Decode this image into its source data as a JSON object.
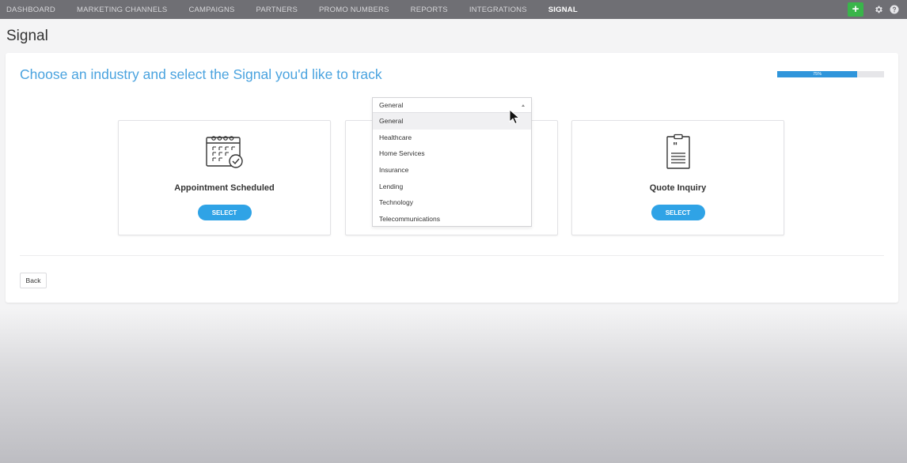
{
  "nav": {
    "items": [
      {
        "label": "DASHBOARD",
        "active": false
      },
      {
        "label": "MARKETING CHANNELS",
        "active": false
      },
      {
        "label": "CAMPAIGNS",
        "active": false
      },
      {
        "label": "PARTNERS",
        "active": false
      },
      {
        "label": "PROMO NUMBERS",
        "active": false
      },
      {
        "label": "REPORTS",
        "active": false
      },
      {
        "label": "INTEGRATIONS",
        "active": false
      },
      {
        "label": "SIGNAL",
        "active": true
      }
    ],
    "add_label": "+",
    "icons": [
      "plus-icon",
      "gear-icon",
      "help-icon"
    ]
  },
  "page": {
    "title": "Signal"
  },
  "panel": {
    "heading": "Choose an industry and select the Signal you'd like to track",
    "progress_label": "75%",
    "progress_value": 0.75,
    "cards": [
      {
        "title": "Appointment Scheduled",
        "button": "SELECT",
        "icon": "calendar-check-icon"
      },
      {
        "title": "",
        "button": "",
        "icon": ""
      },
      {
        "title": "Quote Inquiry",
        "button": "SELECT",
        "icon": "clipboard-quote-icon"
      }
    ],
    "back_label": "Back"
  },
  "industry_dropdown": {
    "selected": "General",
    "options": [
      "General",
      "Healthcare",
      "Home Services",
      "Insurance",
      "Lending",
      "Technology",
      "Telecommunications"
    ],
    "hovered": "General"
  },
  "colors": {
    "nav_bg": "#6f6f74",
    "accent": "#2fa3e6",
    "heading": "#4aa3df",
    "add_button": "#39b54a"
  }
}
